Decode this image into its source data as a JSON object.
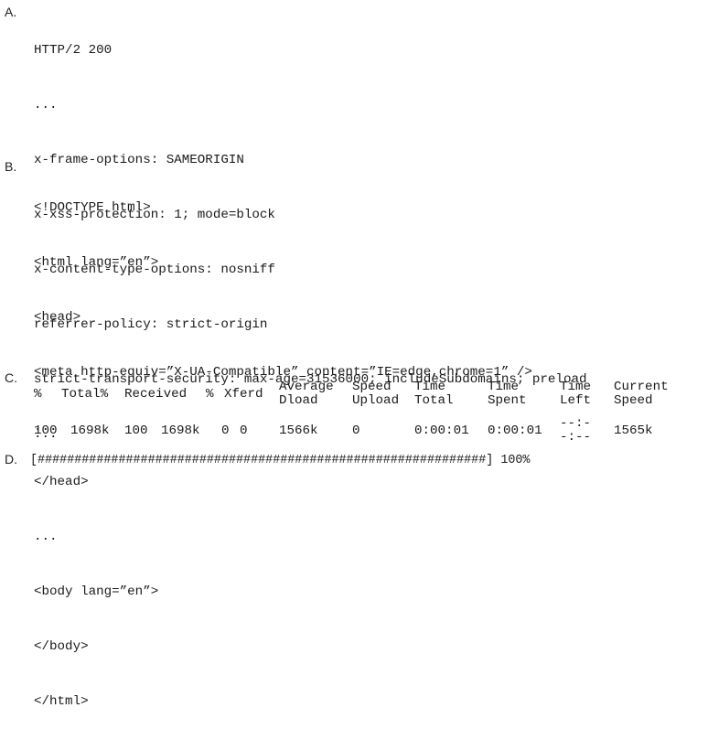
{
  "sections": {
    "a": {
      "label": "A.",
      "lines": [
        "HTTP/2 200",
        "...",
        "x-frame-options: SAMEORIGIN",
        "x-xss-protection: 1; mode=block",
        "x-content-type-options: nosniff",
        "referrer-policy: strict-origin",
        "strict-transport-security: max-age=31536000; includeSubdomains; preload",
        "..."
      ]
    },
    "b": {
      "label": "B.",
      "lines": [
        "<!DOCTYPE html>",
        "<html lang=”en”>",
        "<head>",
        "<meta http-equiv=”X-UA-Compatible” content=”IE=edge,chrome=1” />",
        "...",
        "</head>",
        "...",
        "<body lang=”en”>",
        "</body>",
        "</html>"
      ]
    },
    "c": {
      "label": "C.",
      "headers": [
        {
          "line1": "%",
          "line2": ""
        },
        {
          "line1": "Total%",
          "line2": ""
        },
        {
          "line1": "Received",
          "line2": ""
        },
        {
          "line1": "%",
          "line2": ""
        },
        {
          "line1": "Xferd",
          "line2": ""
        },
        {
          "line1": "Average",
          "line2": "Dload"
        },
        {
          "line1": "Speed",
          "line2": "Upload"
        },
        {
          "line1": "Time",
          "line2": "Total"
        },
        {
          "line1": "Time",
          "line2": "Spent"
        },
        {
          "line1": "Time",
          "line2": "Left"
        },
        {
          "line1": "Current",
          "line2": "Speed"
        }
      ],
      "values": {
        "percent": "100",
        "total": "1698k",
        "received_percent": "100",
        "received": "1698k",
        "xferd_percent": "0",
        "xferd": "0",
        "average_dload": "1566k",
        "speed_upload": "0",
        "time_total": "0:00:01",
        "time_spent": "0:00:01",
        "time_left_line1": "--:-",
        "time_left_line2": "-:--",
        "current_speed": "1565k"
      }
    },
    "d": {
      "label": "D.",
      "bar_open": "[",
      "bar_fill": "#############################################################",
      "bar_close": "]",
      "progress_percent": 100,
      "progress_text": "100%"
    }
  }
}
